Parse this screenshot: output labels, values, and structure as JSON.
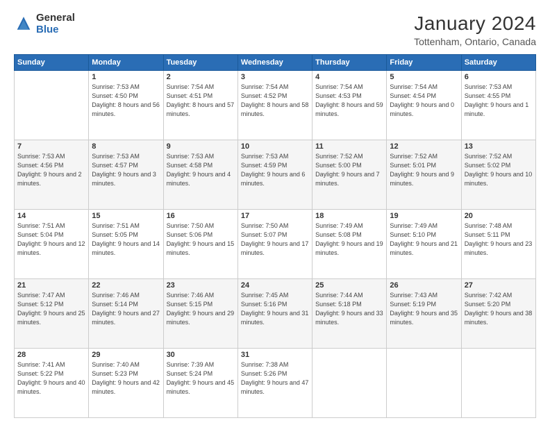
{
  "logo": {
    "general": "General",
    "blue": "Blue"
  },
  "title": "January 2024",
  "subtitle": "Tottenham, Ontario, Canada",
  "days_header": [
    "Sunday",
    "Monday",
    "Tuesday",
    "Wednesday",
    "Thursday",
    "Friday",
    "Saturday"
  ],
  "weeks": [
    [
      {
        "day": "",
        "sunrise": "",
        "sunset": "",
        "daylight": ""
      },
      {
        "day": "1",
        "sunrise": "Sunrise: 7:53 AM",
        "sunset": "Sunset: 4:50 PM",
        "daylight": "Daylight: 8 hours and 56 minutes."
      },
      {
        "day": "2",
        "sunrise": "Sunrise: 7:54 AM",
        "sunset": "Sunset: 4:51 PM",
        "daylight": "Daylight: 8 hours and 57 minutes."
      },
      {
        "day": "3",
        "sunrise": "Sunrise: 7:54 AM",
        "sunset": "Sunset: 4:52 PM",
        "daylight": "Daylight: 8 hours and 58 minutes."
      },
      {
        "day": "4",
        "sunrise": "Sunrise: 7:54 AM",
        "sunset": "Sunset: 4:53 PM",
        "daylight": "Daylight: 8 hours and 59 minutes."
      },
      {
        "day": "5",
        "sunrise": "Sunrise: 7:54 AM",
        "sunset": "Sunset: 4:54 PM",
        "daylight": "Daylight: 9 hours and 0 minutes."
      },
      {
        "day": "6",
        "sunrise": "Sunrise: 7:53 AM",
        "sunset": "Sunset: 4:55 PM",
        "daylight": "Daylight: 9 hours and 1 minute."
      }
    ],
    [
      {
        "day": "7",
        "sunrise": "Sunrise: 7:53 AM",
        "sunset": "Sunset: 4:56 PM",
        "daylight": "Daylight: 9 hours and 2 minutes."
      },
      {
        "day": "8",
        "sunrise": "Sunrise: 7:53 AM",
        "sunset": "Sunset: 4:57 PM",
        "daylight": "Daylight: 9 hours and 3 minutes."
      },
      {
        "day": "9",
        "sunrise": "Sunrise: 7:53 AM",
        "sunset": "Sunset: 4:58 PM",
        "daylight": "Daylight: 9 hours and 4 minutes."
      },
      {
        "day": "10",
        "sunrise": "Sunrise: 7:53 AM",
        "sunset": "Sunset: 4:59 PM",
        "daylight": "Daylight: 9 hours and 6 minutes."
      },
      {
        "day": "11",
        "sunrise": "Sunrise: 7:52 AM",
        "sunset": "Sunset: 5:00 PM",
        "daylight": "Daylight: 9 hours and 7 minutes."
      },
      {
        "day": "12",
        "sunrise": "Sunrise: 7:52 AM",
        "sunset": "Sunset: 5:01 PM",
        "daylight": "Daylight: 9 hours and 9 minutes."
      },
      {
        "day": "13",
        "sunrise": "Sunrise: 7:52 AM",
        "sunset": "Sunset: 5:02 PM",
        "daylight": "Daylight: 9 hours and 10 minutes."
      }
    ],
    [
      {
        "day": "14",
        "sunrise": "Sunrise: 7:51 AM",
        "sunset": "Sunset: 5:04 PM",
        "daylight": "Daylight: 9 hours and 12 minutes."
      },
      {
        "day": "15",
        "sunrise": "Sunrise: 7:51 AM",
        "sunset": "Sunset: 5:05 PM",
        "daylight": "Daylight: 9 hours and 14 minutes."
      },
      {
        "day": "16",
        "sunrise": "Sunrise: 7:50 AM",
        "sunset": "Sunset: 5:06 PM",
        "daylight": "Daylight: 9 hours and 15 minutes."
      },
      {
        "day": "17",
        "sunrise": "Sunrise: 7:50 AM",
        "sunset": "Sunset: 5:07 PM",
        "daylight": "Daylight: 9 hours and 17 minutes."
      },
      {
        "day": "18",
        "sunrise": "Sunrise: 7:49 AM",
        "sunset": "Sunset: 5:08 PM",
        "daylight": "Daylight: 9 hours and 19 minutes."
      },
      {
        "day": "19",
        "sunrise": "Sunrise: 7:49 AM",
        "sunset": "Sunset: 5:10 PM",
        "daylight": "Daylight: 9 hours and 21 minutes."
      },
      {
        "day": "20",
        "sunrise": "Sunrise: 7:48 AM",
        "sunset": "Sunset: 5:11 PM",
        "daylight": "Daylight: 9 hours and 23 minutes."
      }
    ],
    [
      {
        "day": "21",
        "sunrise": "Sunrise: 7:47 AM",
        "sunset": "Sunset: 5:12 PM",
        "daylight": "Daylight: 9 hours and 25 minutes."
      },
      {
        "day": "22",
        "sunrise": "Sunrise: 7:46 AM",
        "sunset": "Sunset: 5:14 PM",
        "daylight": "Daylight: 9 hours and 27 minutes."
      },
      {
        "day": "23",
        "sunrise": "Sunrise: 7:46 AM",
        "sunset": "Sunset: 5:15 PM",
        "daylight": "Daylight: 9 hours and 29 minutes."
      },
      {
        "day": "24",
        "sunrise": "Sunrise: 7:45 AM",
        "sunset": "Sunset: 5:16 PM",
        "daylight": "Daylight: 9 hours and 31 minutes."
      },
      {
        "day": "25",
        "sunrise": "Sunrise: 7:44 AM",
        "sunset": "Sunset: 5:18 PM",
        "daylight": "Daylight: 9 hours and 33 minutes."
      },
      {
        "day": "26",
        "sunrise": "Sunrise: 7:43 AM",
        "sunset": "Sunset: 5:19 PM",
        "daylight": "Daylight: 9 hours and 35 minutes."
      },
      {
        "day": "27",
        "sunrise": "Sunrise: 7:42 AM",
        "sunset": "Sunset: 5:20 PM",
        "daylight": "Daylight: 9 hours and 38 minutes."
      }
    ],
    [
      {
        "day": "28",
        "sunrise": "Sunrise: 7:41 AM",
        "sunset": "Sunset: 5:22 PM",
        "daylight": "Daylight: 9 hours and 40 minutes."
      },
      {
        "day": "29",
        "sunrise": "Sunrise: 7:40 AM",
        "sunset": "Sunset: 5:23 PM",
        "daylight": "Daylight: 9 hours and 42 minutes."
      },
      {
        "day": "30",
        "sunrise": "Sunrise: 7:39 AM",
        "sunset": "Sunset: 5:24 PM",
        "daylight": "Daylight: 9 hours and 45 minutes."
      },
      {
        "day": "31",
        "sunrise": "Sunrise: 7:38 AM",
        "sunset": "Sunset: 5:26 PM",
        "daylight": "Daylight: 9 hours and 47 minutes."
      },
      {
        "day": "",
        "sunrise": "",
        "sunset": "",
        "daylight": ""
      },
      {
        "day": "",
        "sunrise": "",
        "sunset": "",
        "daylight": ""
      },
      {
        "day": "",
        "sunrise": "",
        "sunset": "",
        "daylight": ""
      }
    ]
  ]
}
